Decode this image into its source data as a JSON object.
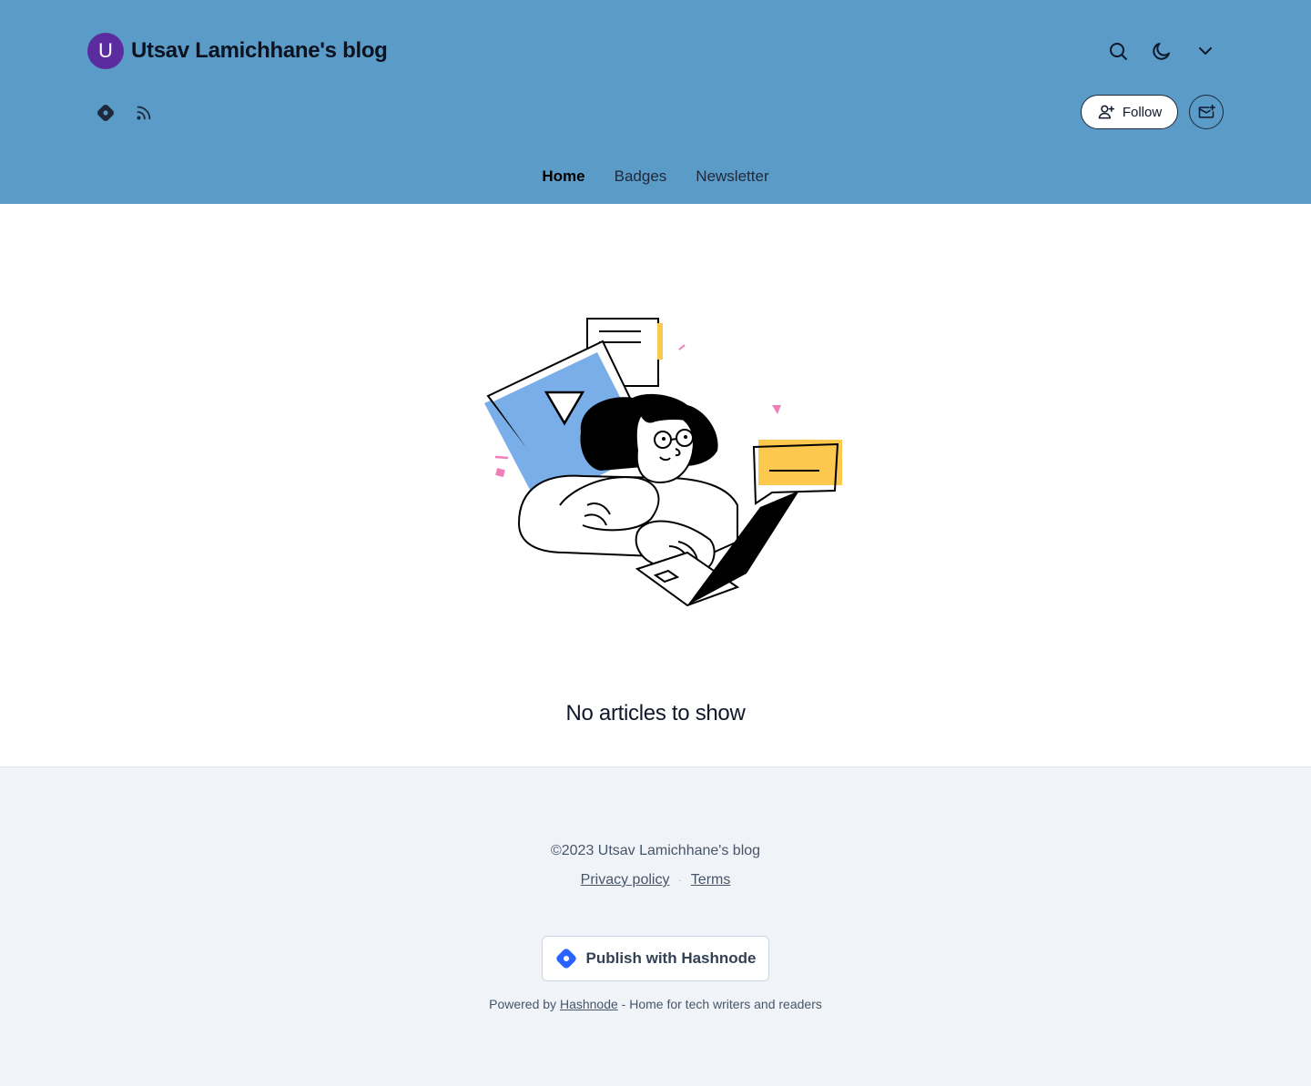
{
  "header": {
    "avatar_letter": "U",
    "blog_title": "Utsav Lamichhane's blog",
    "background_color": "#5b9bc8",
    "top_icons": [
      "search-icon",
      "moon-icon",
      "chevron-down-icon"
    ],
    "social_icons": [
      "hashnode-icon",
      "rss-icon"
    ],
    "follow_label": "Follow",
    "newsletter_icon": "mail-plus-icon"
  },
  "nav": {
    "items": [
      {
        "label": "Home",
        "active": true
      },
      {
        "label": "Badges",
        "active": false
      },
      {
        "label": "Newsletter",
        "active": false
      }
    ]
  },
  "main": {
    "empty_message": "No articles to show"
  },
  "footer": {
    "copyright": "©2023 Utsav Lamichhane's blog",
    "privacy_label": "Privacy policy",
    "separator": "·",
    "terms_label": "Terms",
    "publish_label": "Publish with Hashnode",
    "powered_prefix": "Powered by",
    "powered_link": "Hashnode",
    "powered_suffix": "- Home for tech writers and readers",
    "brand_color": "#2962ff"
  }
}
